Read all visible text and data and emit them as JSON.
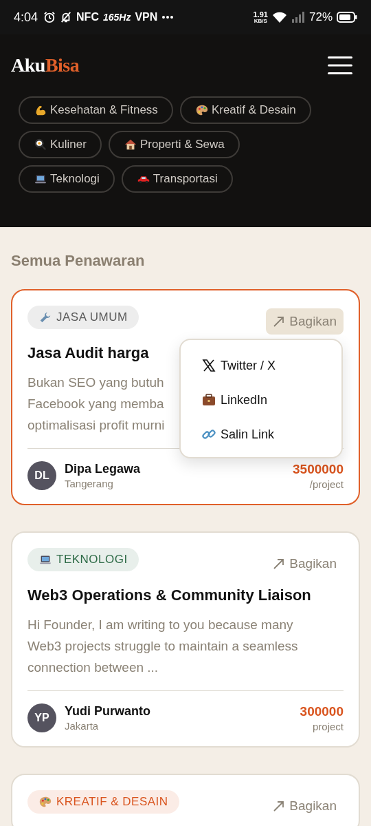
{
  "status_bar": {
    "time": "4:04",
    "nfc": "NFC",
    "refresh": "165Hz",
    "vpn": "VPN",
    "speed_value": "1.91",
    "speed_unit": "KB/S",
    "battery": "72%"
  },
  "header": {
    "logo_start": "Aku",
    "logo_end": "Bisa"
  },
  "categories": [
    {
      "label": "Kesehatan & Fitness",
      "kind": "fitness"
    },
    {
      "label": "Kreatif & Desain",
      "kind": "creative"
    },
    {
      "label": "Kuliner",
      "kind": "food"
    },
    {
      "label": "Properti & Sewa",
      "kind": "property"
    },
    {
      "label": "Teknologi",
      "kind": "tech"
    },
    {
      "label": "Transportasi",
      "kind": "transport"
    }
  ],
  "section_title": "Semua Penawaran",
  "offers": [
    {
      "tag": {
        "label": "JASA UMUM",
        "kind": "tools",
        "color": "#5a5a5a"
      },
      "share": "Bagikan",
      "selected": true,
      "title": "Jasa Audit harga",
      "lines": [
        "Bukan SEO yang butuh",
        "Facebook yang memba",
        "optimalisasi profit murni"
      ],
      "initials": "DL",
      "name": "Dipa Legawa",
      "location": "Tangerang",
      "price": "3500000",
      "unit": "/project",
      "share_menu": [
        {
          "label": "Twitter / X",
          "kind": "x"
        },
        {
          "label": "LinkedIn",
          "kind": "briefcase"
        },
        {
          "label": "Salin Link",
          "kind": "link"
        }
      ]
    },
    {
      "tag": {
        "label": "TEKNOLOGI",
        "kind": "tech",
        "color": "#2e6b47"
      },
      "share": "Bagikan",
      "selected": false,
      "title": "Web3 Operations & Community Liaison",
      "lines": [
        "Hi Founder, I am writing to you because many",
        "Web3 projects struggle to maintain a seamless",
        "connection between ..."
      ],
      "initials": "YP",
      "name": "Yudi Purwanto",
      "location": "Jakarta",
      "price": "300000",
      "unit": "project"
    },
    {
      "tag": {
        "label": "KREATIF & DESAIN",
        "kind": "creative",
        "color": "#d9541e"
      },
      "share": "Bagikan",
      "selected": false
    }
  ]
}
